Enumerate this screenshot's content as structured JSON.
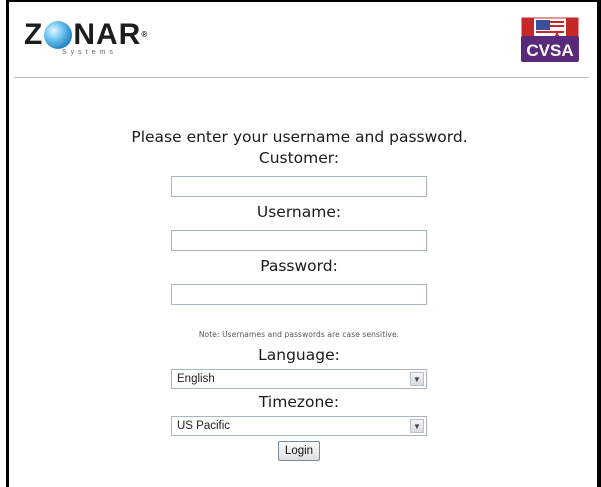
{
  "header": {
    "logo_left": {
      "word_before": "Z",
      "word_after": "NAR",
      "mark": "®",
      "subtitle": "Systems"
    },
    "logo_right": {
      "text": "CVSA"
    }
  },
  "login": {
    "prompt": "Please enter your username and password.",
    "customer_label": "Customer:",
    "customer_value": "",
    "username_label": "Username:",
    "username_value": "",
    "password_label": "Password:",
    "password_value": "",
    "note": "Note:  Usernames and passwords are case sensitive.",
    "language_label": "Language:",
    "language_value": "English",
    "timezone_label": "Timezone:",
    "timezone_value": "US Pacific",
    "login_button": "Login"
  },
  "icons": {
    "dropdown_arrow": "chevron-down-icon",
    "globe": "globe-icon"
  },
  "colors": {
    "accent_blue": "#1f7fc0",
    "flag_red": "#c62828",
    "cvsa_purple": "#5a2a7a"
  }
}
